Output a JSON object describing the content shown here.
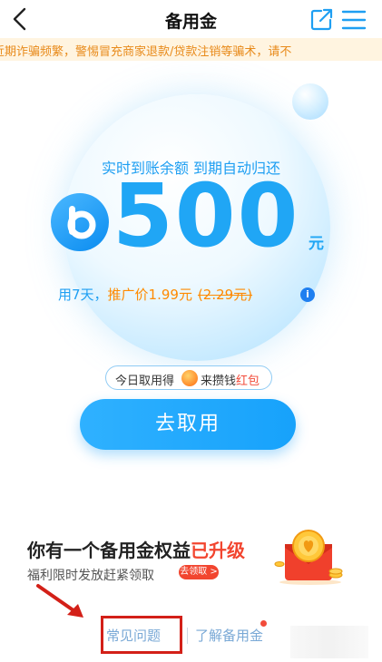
{
  "header": {
    "title": "备用金",
    "back_icon": "chevron-left-icon",
    "share_icon": "share-out-icon",
    "menu_icon": "hamburger-menu-icon"
  },
  "notice": {
    "text": "近期诈骗频繁，警惕冒充商家退款/贷款注销等骗术，请不"
  },
  "hero": {
    "tagline": "实时到账余额 到期自动归还",
    "amount": "500",
    "currency": "元",
    "term_text": "用7天，",
    "promo_label": "推广价1.99元",
    "original_price": "(2.29元)",
    "info_icon": "info-icon"
  },
  "promo": {
    "prefix": "今日取用得",
    "middle": "来攒钱",
    "highlight": "红包",
    "icon": "red-packet-icon"
  },
  "cta": {
    "label": "去取用"
  },
  "upgrade": {
    "title_prefix": "你有一个备用金权益",
    "title_highlight": "已升级",
    "subtitle": "福利限时发放赶紧领取",
    "badge": "去领取 >",
    "icon": "red-envelope-coins-icon"
  },
  "footer": {
    "faq_label": "常见问题",
    "learn_label": "了解备用金",
    "arrow_icon": "annotation-arrow-icon"
  },
  "colors": {
    "brand_blue": "#1f9ff2",
    "orange": "#ff8a00",
    "red": "#f2452f",
    "annotation_red": "#d32018"
  }
}
